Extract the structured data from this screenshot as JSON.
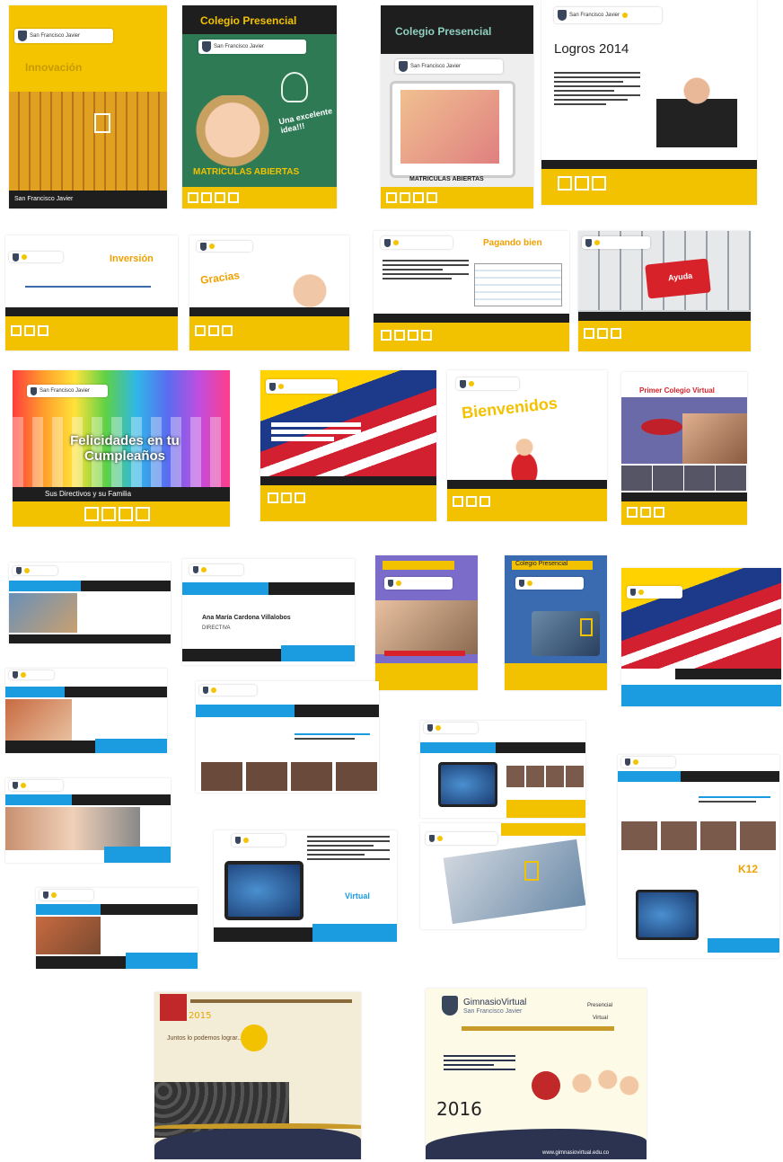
{
  "flyers": {
    "f1_title": "Innovación",
    "f1_footer": "San Francisco Javier",
    "f2_heading": "Colegio Presencial",
    "f2_bubble": "Una excelente idea!!!",
    "f2_footer": "MATRICULAS ABIERTAS",
    "f3_heading": "Colegio Presencial",
    "f3_footer": "MATRICULAS ABIERTAS",
    "f4_title": "Logros 2014",
    "f5_title": "Inversión",
    "f6_title": "Gracias",
    "f7_title": "Pagando bien",
    "f8_key": "Ayuda",
    "f9_title": "Felicidades en tu Cumpleaños",
    "f9_sub": "Sus Directivos y su Familia",
    "f11_title": "Bienvenidos",
    "f12_title": "Primer Colegio Virtual",
    "f16_name": "Ana María Cardona Villalobos",
    "f16_role": "DIRECTIVA",
    "f18_tab": "Colegio Presencial",
    "f24_link": "Virtual",
    "f26_badge": "K12",
    "bottom_left_slogan": "Juntos lo podemos lograr...",
    "bottom_right_brand": "GimnasioVirtual",
    "bottom_right_sub": "San Francisco Javier",
    "bottom_right_opt1": "Presencial",
    "bottom_right_opt2": "Virtual",
    "bottom_right_url": "www.gimnasiovirtual.edu.co"
  },
  "labels": {
    "year_2015": "2015",
    "year_2016": "2016"
  },
  "colors": {
    "yellow": "#f2c200",
    "dark": "#1e1e1e",
    "blue": "#1b9be0",
    "green": "#2d7a55",
    "navy": "#2b3350"
  }
}
